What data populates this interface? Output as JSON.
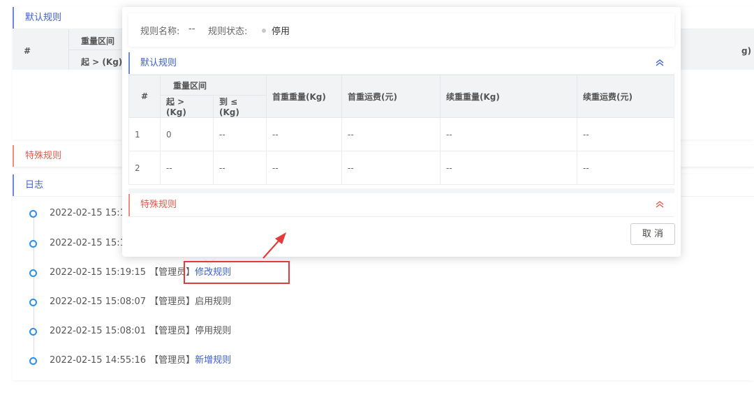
{
  "background": {
    "default_rules_title": "默认规则",
    "special_rules_title": "特殊规则",
    "log_title": "日志",
    "table_headers": {
      "index": "#",
      "weight_range": "重量区间",
      "from": "起 > (Kg)",
      "right_cut": "g)"
    },
    "log_entries": [
      {
        "time": "2022-02-15 15:19",
        "role": "",
        "action": "",
        "action_type": "plain"
      },
      {
        "time": "2022-02-15 15:19",
        "role": "",
        "action": "",
        "action_type": "plain"
      },
      {
        "time": "2022-02-15 15:19:15",
        "role": "【管理员】",
        "action": "修改规则",
        "action_type": "link"
      },
      {
        "time": "2022-02-15 15:08:07",
        "role": "【管理员】",
        "action": "启用规则",
        "action_type": "plain"
      },
      {
        "time": "2022-02-15 15:08:01",
        "role": "【管理员】",
        "action": "停用规则",
        "action_type": "plain"
      },
      {
        "time": "2022-02-15 14:55:16",
        "role": "【管理员】",
        "action": "新增规则",
        "action_type": "link"
      }
    ]
  },
  "popover": {
    "rule_name_label": "规则名称:",
    "rule_name_value": "--",
    "rule_status_label": "规则状态:",
    "rule_status_value": "停用",
    "default_rules_title": "默认规则",
    "special_rules_title": "特殊规则",
    "table": {
      "headers": {
        "index": "#",
        "weight_range": "重量区间",
        "from": "起 > (Kg)",
        "to": "到 ≤ (Kg)",
        "first_weight": "首重重量(Kg)",
        "first_fee": "首重运费(元)",
        "extra_weight": "续重重量(Kg)",
        "extra_fee": "续重运费(元)"
      },
      "rows": [
        [
          "1",
          "0",
          "--",
          "--",
          "--",
          "--",
          "--"
        ],
        [
          "2",
          "--",
          "--",
          "--",
          "--",
          "--",
          "--"
        ]
      ]
    },
    "cancel_label": "取 消"
  },
  "colors": {
    "accent_blue": "#3a5fc8",
    "accent_red": "#e0594a",
    "annotation_red": "#e23b3b",
    "timeline_blue": "#2d8cf0"
  }
}
